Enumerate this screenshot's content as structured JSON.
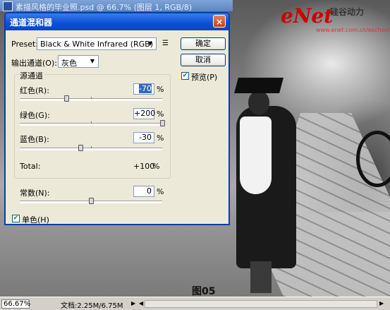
{
  "window": {
    "title": "素描风格的毕业照.psd @ 66.7% (图层 1, RGB/8)"
  },
  "brand": {
    "logo": "eNet",
    "subtitle": "硅谷动力",
    "url": "www.enet.com.cn/eschool"
  },
  "dialog": {
    "title": "通道混和器",
    "close_symbol": "×",
    "preset": {
      "label": "Preset:",
      "value": "Black & White Infrared (RGB)",
      "icon": "list-menu-icon"
    },
    "output_channel": {
      "label": "输出通道(O):",
      "value": "灰色"
    },
    "buttons": {
      "ok": "确定",
      "cancel": "取消"
    },
    "preview": {
      "label": "预览(P)",
      "checked": true
    },
    "source_group": {
      "title": "源通道",
      "channels": [
        {
          "label": "红色(R):",
          "value": "-70",
          "unit": "%",
          "percent": -70
        },
        {
          "label": "绿色(G):",
          "value": "+200",
          "unit": "%",
          "percent": 200
        },
        {
          "label": "蓝色(B):",
          "value": "-30",
          "unit": "%",
          "percent": -30
        }
      ],
      "total_label": "Total:",
      "total_value": "+100",
      "total_unit": "%"
    },
    "constant": {
      "label": "常数(N):",
      "value": "0",
      "unit": "%",
      "percent": 0
    },
    "monochrome": {
      "label": "单色(H)",
      "checked": true
    }
  },
  "figure_label": "图05",
  "statusbar": {
    "zoom": "66.67%",
    "doc": "文档:2.25M/6.75M"
  }
}
